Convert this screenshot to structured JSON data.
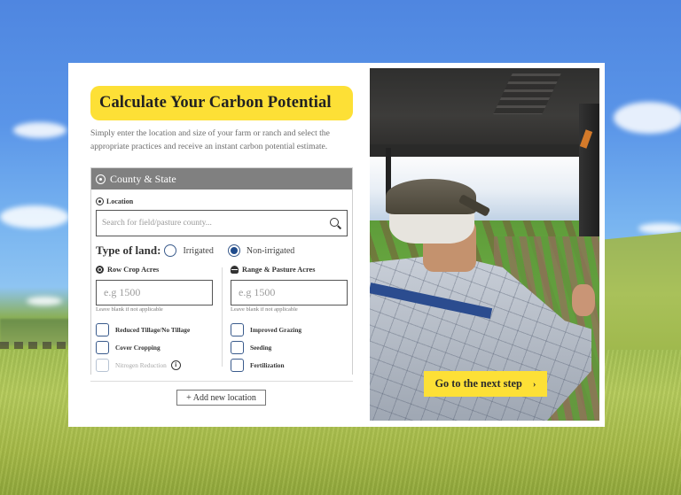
{
  "calculator": {
    "title": "Calculate Your Carbon Potential",
    "intro": "Simply enter the location and size of your farm or ranch and select the appropriate practices and receive an instant carbon potential estimate.",
    "section_title": "County & State",
    "location": {
      "label": "Location",
      "placeholder": "Search for field/pasture county...",
      "value": ""
    },
    "land_type": {
      "label": "Type of land:",
      "options": [
        {
          "label": "Irrigated",
          "selected": false
        },
        {
          "label": "Non-irrigated",
          "selected": true
        }
      ]
    },
    "row_crop": {
      "label": "Row Crop Acres",
      "placeholder": "e.g 1500",
      "value": "",
      "hint": "Leave blank if not applicable",
      "practices": [
        {
          "label": "Reduced Tillage/No Tillage",
          "checked": false,
          "disabled": false
        },
        {
          "label": "Cover Cropping",
          "checked": false,
          "disabled": false
        },
        {
          "label": "Nitrogen Reduction",
          "checked": false,
          "disabled": true,
          "info": "i"
        }
      ]
    },
    "range_pasture": {
      "label": "Range & Pasture Acres",
      "placeholder": "e.g 1500",
      "value": "",
      "hint": "Leave blank if not applicable",
      "practices": [
        {
          "label": "Improved Grazing",
          "checked": false,
          "disabled": false
        },
        {
          "label": "Seeding",
          "checked": false,
          "disabled": false
        },
        {
          "label": "Fertilization",
          "checked": false,
          "disabled": false
        }
      ]
    },
    "add_location_label": "+ Add new location"
  },
  "photo": {
    "description": "Farmer in cap riding a utility vehicle through green crop rows",
    "cta_label": "Go to the next step",
    "cta_icon": "›"
  },
  "colors": {
    "accent_yellow": "#fde036",
    "section_header_gray": "#808080",
    "control_blue": "#1f4b8c"
  }
}
